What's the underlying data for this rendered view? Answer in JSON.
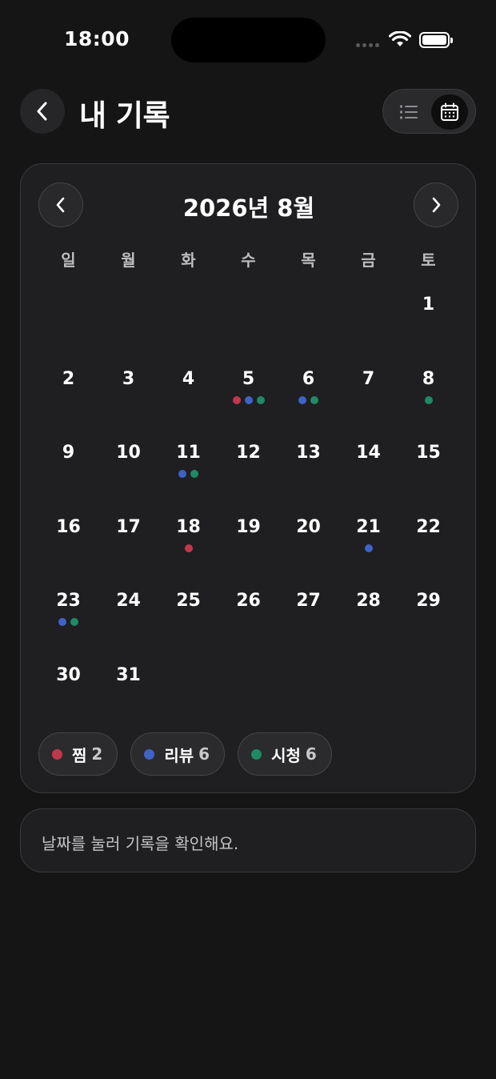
{
  "status_bar": {
    "time": "18:00"
  },
  "header": {
    "title": "내 기록",
    "back_icon": "chevron-left-icon",
    "view_options": [
      "list-icon",
      "calendar-icon"
    ],
    "selected_view": "calendar"
  },
  "calendar": {
    "month_label": "2026년 8월",
    "weekdays": [
      "일",
      "월",
      "화",
      "수",
      "목",
      "금",
      "토"
    ],
    "first_weekday_index": 6,
    "days": [
      {
        "day": "1",
        "dots": []
      },
      {
        "day": "2",
        "dots": []
      },
      {
        "day": "3",
        "dots": []
      },
      {
        "day": "4",
        "dots": []
      },
      {
        "day": "5",
        "dots": [
          "zzim",
          "review",
          "watch"
        ]
      },
      {
        "day": "6",
        "dots": [
          "review",
          "watch"
        ]
      },
      {
        "day": "7",
        "dots": []
      },
      {
        "day": "8",
        "dots": [
          "watch"
        ]
      },
      {
        "day": "9",
        "dots": []
      },
      {
        "day": "10",
        "dots": []
      },
      {
        "day": "11",
        "dots": [
          "review",
          "watch"
        ]
      },
      {
        "day": "12",
        "dots": []
      },
      {
        "day": "13",
        "dots": []
      },
      {
        "day": "14",
        "dots": []
      },
      {
        "day": "15",
        "dots": []
      },
      {
        "day": "16",
        "dots": []
      },
      {
        "day": "17",
        "dots": []
      },
      {
        "day": "18",
        "dots": [
          "zzim"
        ]
      },
      {
        "day": "19",
        "dots": []
      },
      {
        "day": "20",
        "dots": []
      },
      {
        "day": "21",
        "dots": [
          "review"
        ]
      },
      {
        "day": "22",
        "dots": []
      },
      {
        "day": "23",
        "dots": [
          "review",
          "watch"
        ]
      },
      {
        "day": "24",
        "dots": []
      },
      {
        "day": "25",
        "dots": []
      },
      {
        "day": "26",
        "dots": []
      },
      {
        "day": "27",
        "dots": []
      },
      {
        "day": "28",
        "dots": []
      },
      {
        "day": "29",
        "dots": []
      },
      {
        "day": "30",
        "dots": []
      },
      {
        "day": "31",
        "dots": []
      }
    ]
  },
  "legend": [
    {
      "key": "zzim",
      "label": "찜",
      "count": "2",
      "color": "#c0394b"
    },
    {
      "key": "review",
      "label": "리뷰",
      "count": "6",
      "color": "#3d63c7"
    },
    {
      "key": "watch",
      "label": "시청",
      "count": "6",
      "color": "#1f8a63"
    }
  ],
  "hint": {
    "text": "날짜를 눌러 기록을 확인해요."
  }
}
